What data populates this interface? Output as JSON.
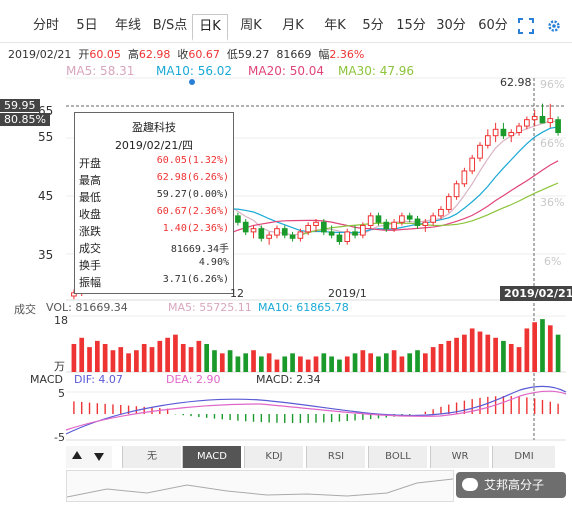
{
  "top_banner": "",
  "tabs": [
    "分时",
    "5日",
    "年线",
    "B/S点",
    "日K",
    "周K",
    "月K",
    "年K",
    "5分",
    "15分",
    "30分",
    "60分"
  ],
  "active_tab": "日K",
  "info": {
    "date": "2019/02/21",
    "open_label": "开",
    "open": "60.05",
    "high_label": "高",
    "high": "62.98",
    "close_label": "收",
    "close": "60.67",
    "low_label": "低",
    "low": "59.27",
    "vol": "81669",
    "amp_label": "幅",
    "amp": "2.36%"
  },
  "ma": {
    "ma5": "MA5: 58.31",
    "ma10": "MA10: 56.02",
    "ma20": "MA20: 50.04",
    "ma30": "MA30: 47.96"
  },
  "price_axis": [
    "65",
    "55",
    "45",
    "35"
  ],
  "pct_axis": [
    "96%",
    "66%",
    "36%",
    "6%"
  ],
  "cursor": {
    "price": "59.95",
    "pct": "80.85%",
    "date": "2019/02/21"
  },
  "high_label": "62.98",
  "tooltip": {
    "title": "盈趣科技",
    "date": "2019/02/21/四",
    "rows": [
      {
        "k": "开盘",
        "v": "60.05(1.32%)"
      },
      {
        "k": "最高",
        "v": "62.98(6.26%)"
      },
      {
        "k": "最低",
        "v": "59.27(0.00%)"
      },
      {
        "k": "收盘",
        "v": "60.67(2.36%)"
      },
      {
        "k": "涨跌",
        "v": "1.40(2.36%)"
      },
      {
        "k": "成交",
        "v": "81669.34手"
      },
      {
        "k": "换手",
        "v": "4.90%"
      },
      {
        "k": "振幅",
        "v": "3.71(6.26%)"
      }
    ]
  },
  "x_labels": {
    "month1": "12",
    "month2": "2019/1"
  },
  "volume": {
    "label": "成交",
    "vol": "VOL: 81669.34",
    "ma5": "MA5: 55725.11",
    "ma10": "MA10: 61865.78",
    "y_top": "18",
    "unit": "万"
  },
  "macd": {
    "label": "MACD",
    "dif": "DIF: 4.07",
    "dea": "DEA: 2.90",
    "macd": "MACD: 2.34",
    "y_top": "5",
    "y_bottom": "-5"
  },
  "indicators": [
    "无",
    "MACD",
    "KDJ",
    "RSI",
    "BOLL",
    "WR",
    "DMI"
  ],
  "active_indicator": "MACD",
  "watermark": "艾邦高分子",
  "colors": {
    "up": "#e33",
    "down": "#1a9a2a",
    "ma5": "#d9b3c4",
    "ma10": "#1aa9d6",
    "ma20": "#e0457a",
    "ma30": "#8cc43c",
    "dif": "#5a5ad6",
    "dea": "#e066c8"
  },
  "chart_data": {
    "type": "candlestick",
    "ylim": [
      33,
      67
    ],
    "candles": [
      [
        33,
        34,
        32.5,
        33.5
      ],
      [
        33.5,
        35,
        33,
        34.5
      ],
      [
        34.5,
        36,
        34,
        35.5
      ],
      [
        35.5,
        37,
        35,
        36.5
      ],
      [
        36.5,
        38,
        36,
        37.5
      ],
      [
        37.5,
        39,
        37,
        38.5
      ],
      [
        38.5,
        40,
        38,
        39.5
      ],
      [
        39.5,
        41,
        39,
        40.5
      ],
      [
        40.5,
        42,
        40,
        41.5
      ],
      [
        41.5,
        43,
        41,
        42.5
      ],
      [
        42.5,
        44,
        42,
        43.5
      ],
      [
        43.5,
        45,
        43,
        44.5
      ],
      [
        44.5,
        46,
        44,
        45
      ],
      [
        45,
        47,
        44,
        46
      ],
      [
        46,
        48,
        45,
        47
      ],
      [
        47,
        49,
        46,
        48
      ],
      [
        48,
        49.5,
        47,
        48.5
      ],
      [
        48.5,
        49,
        46.5,
        47
      ],
      [
        47,
        48,
        45.5,
        46.5
      ],
      [
        46.5,
        48,
        46,
        47.5
      ],
      [
        47.5,
        48,
        45,
        45.5
      ],
      [
        45.5,
        46,
        44,
        44.5
      ],
      [
        44.5,
        45,
        42.5,
        43
      ],
      [
        43,
        44,
        42,
        43.5
      ],
      [
        43.5,
        44,
        41.5,
        42
      ],
      [
        42,
        43,
        41,
        42.5
      ],
      [
        42.5,
        44,
        42,
        43.5
      ],
      [
        43.5,
        44,
        42,
        42.5
      ],
      [
        42.5,
        43,
        41.5,
        42
      ],
      [
        42,
        43.5,
        41.5,
        43
      ],
      [
        43,
        44.5,
        42.5,
        44
      ],
      [
        44,
        45,
        43,
        44.5
      ],
      [
        44.5,
        45,
        42.5,
        43
      ],
      [
        43,
        44,
        42,
        42.5
      ],
      [
        42.5,
        43,
        41,
        41.5
      ],
      [
        41.5,
        43.5,
        41,
        43
      ],
      [
        43,
        44,
        42,
        42.5
      ],
      [
        42.5,
        44.5,
        42,
        44
      ],
      [
        44,
        46,
        43.5,
        45.5
      ],
      [
        45.5,
        46,
        44,
        44.5
      ],
      [
        44.5,
        45,
        43,
        43.5
      ],
      [
        43.5,
        45,
        43,
        44.5
      ],
      [
        44.5,
        46,
        44,
        45.5
      ],
      [
        45.5,
        46,
        44.5,
        45
      ],
      [
        45,
        45.5,
        43.5,
        44
      ],
      [
        44,
        45,
        43,
        44.5
      ],
      [
        44.5,
        46,
        44,
        45.5
      ],
      [
        45.5,
        47,
        45,
        46.5
      ],
      [
        46.5,
        49,
        46,
        48.5
      ],
      [
        48.5,
        51,
        48,
        50.5
      ],
      [
        50.5,
        53,
        50,
        52.5
      ],
      [
        52.5,
        55,
        52,
        54.5
      ],
      [
        54.5,
        57,
        54,
        56.5
      ],
      [
        56.5,
        59,
        56,
        58
      ],
      [
        58,
        60,
        57,
        59
      ],
      [
        59,
        60,
        57.5,
        58
      ],
      [
        58,
        59,
        57,
        58.5
      ],
      [
        58.5,
        60,
        58,
        59.5
      ],
      [
        59.5,
        61,
        59,
        60.5
      ],
      [
        60.5,
        62,
        59.5,
        61
      ],
      [
        61,
        63,
        60,
        60
      ],
      [
        60.05,
        62.98,
        59.27,
        60.67
      ],
      [
        60.5,
        61,
        58,
        58.5
      ]
    ],
    "volumes": [
      9,
      11,
      8,
      10,
      9,
      7,
      8,
      6,
      7,
      9,
      8,
      10,
      11,
      12,
      9,
      8,
      10,
      9,
      7,
      6,
      7,
      5,
      6,
      7,
      5,
      6,
      4,
      5,
      6,
      5,
      4,
      5,
      6,
      5,
      4,
      5,
      6,
      7,
      6,
      5,
      6,
      7,
      5,
      6,
      7,
      6,
      8,
      9,
      10,
      11,
      12,
      14,
      13,
      12,
      11,
      10,
      9,
      8,
      14,
      16,
      17,
      15,
      12
    ]
  }
}
